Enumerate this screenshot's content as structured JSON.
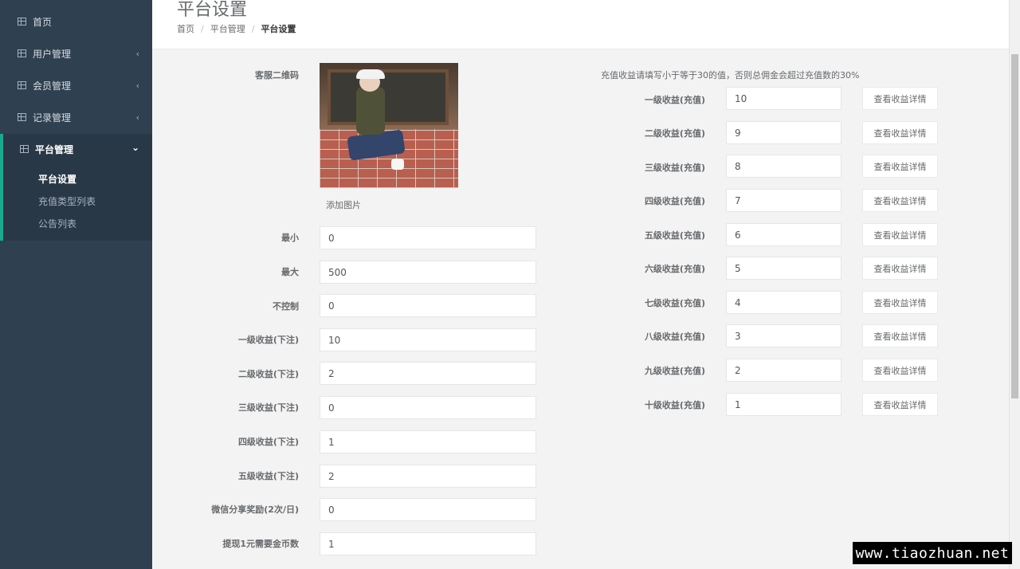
{
  "sidebar": {
    "items": [
      {
        "label": "首页",
        "chevron": ""
      },
      {
        "label": "用户管理",
        "chevron": "‹"
      },
      {
        "label": "会员管理",
        "chevron": "‹"
      },
      {
        "label": "记录管理",
        "chevron": "‹"
      },
      {
        "label": "平台管理",
        "chevron": "⌄"
      }
    ],
    "sub_items": [
      {
        "label": "平台设置"
      },
      {
        "label": "充值类型列表"
      },
      {
        "label": "公告列表"
      }
    ]
  },
  "header": {
    "title": "平台设置",
    "breadcrumb": [
      "首页",
      "平台管理",
      "平台设置"
    ]
  },
  "left_form": {
    "qr_label": "客服二维码",
    "add_image": "添加图片",
    "fields": [
      {
        "label": "最小",
        "value": "0"
      },
      {
        "label": "最大",
        "value": "500"
      },
      {
        "label": "不控制",
        "value": "0"
      },
      {
        "label": "一级收益(下注)",
        "value": "10"
      },
      {
        "label": "二级收益(下注)",
        "value": "2"
      },
      {
        "label": "三级收益(下注)",
        "value": "0"
      },
      {
        "label": "四级收益(下注)",
        "value": "1"
      },
      {
        "label": "五级收益(下注)",
        "value": "2"
      },
      {
        "label": "微信分享奖励(2次/日)",
        "value": "0"
      },
      {
        "label": "提现1元需要金币数",
        "value": "1"
      }
    ]
  },
  "right_form": {
    "note": "充值收益请填写小于等于30的值，否则总佣金会超过充值数的30%",
    "button_label": "查看收益详情",
    "fields": [
      {
        "label": "一级收益(充值)",
        "value": "10"
      },
      {
        "label": "二级收益(充值)",
        "value": "9"
      },
      {
        "label": "三级收益(充值)",
        "value": "8"
      },
      {
        "label": "四级收益(充值)",
        "value": "7"
      },
      {
        "label": "五级收益(充值)",
        "value": "6"
      },
      {
        "label": "六级收益(充值)",
        "value": "5"
      },
      {
        "label": "七级收益(充值)",
        "value": "4"
      },
      {
        "label": "八级收益(充值)",
        "value": "3"
      },
      {
        "label": "九级收益(充值)",
        "value": "2"
      },
      {
        "label": "十级收益(充值)",
        "value": "1"
      }
    ]
  },
  "watermark": "www.tiaozhuan.net",
  "colors": {
    "sidebar_bg": "#2f4050",
    "accent": "#19aa8d",
    "content_bg": "#f3f3f4"
  }
}
